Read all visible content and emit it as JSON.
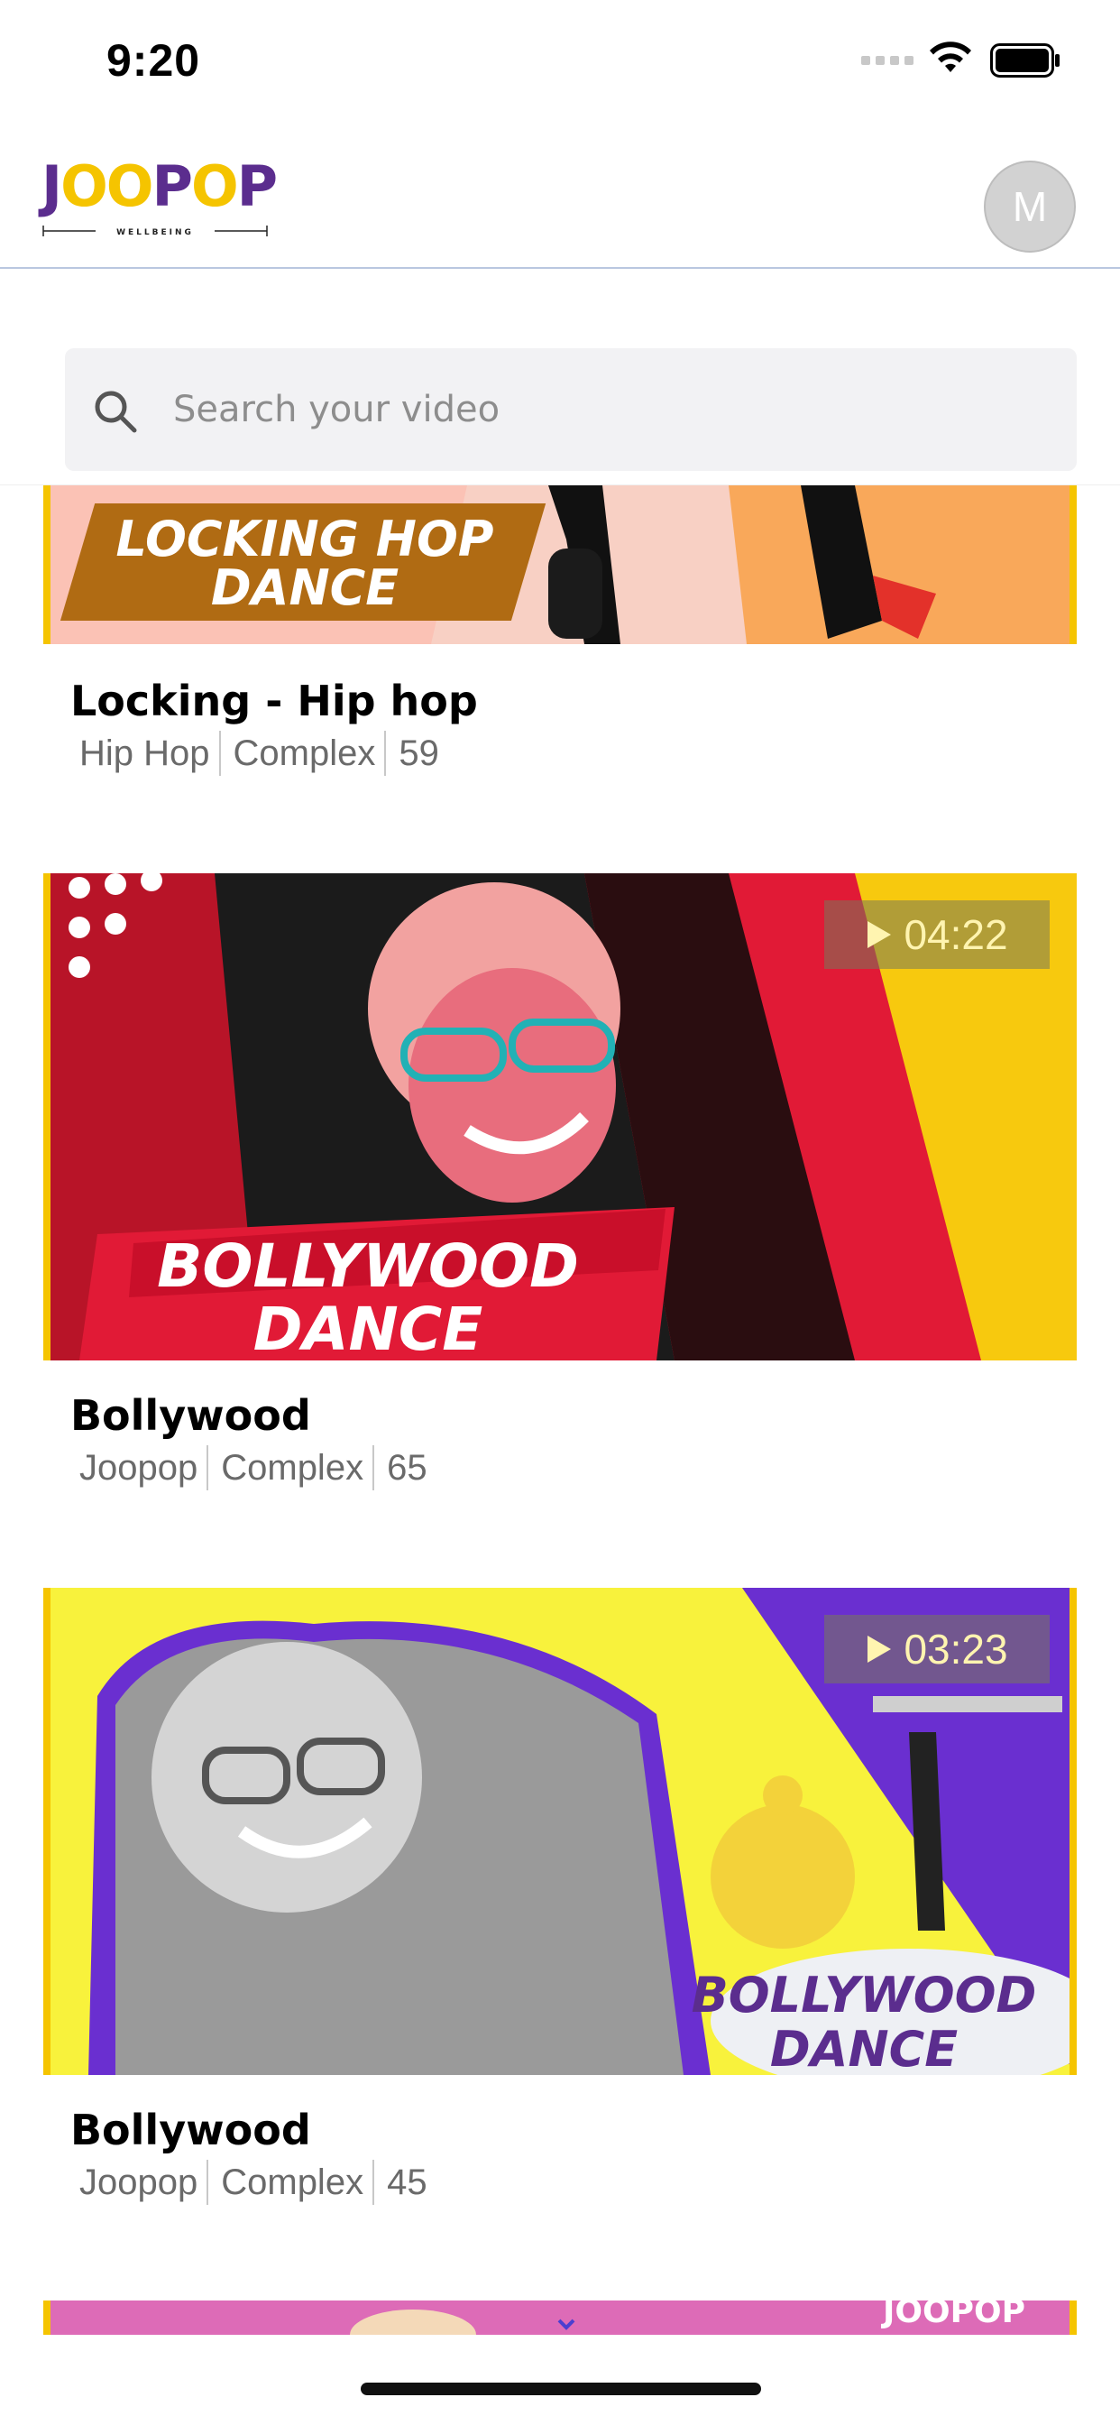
{
  "status_bar": {
    "time": "9:20"
  },
  "header": {
    "logo_text": "JOOPOP",
    "logo_subtitle": "WELLBEING",
    "avatar_initial": "M"
  },
  "search": {
    "placeholder": "Search your video",
    "value": ""
  },
  "videos": [
    {
      "title": "Locking - Hip hop",
      "teacher": "Hip Hop",
      "level": "Complex",
      "count": "59",
      "thumbnail_text_line1": "LOCKING HOP",
      "thumbnail_text_line2": "DANCE"
    },
    {
      "title": "Bollywood",
      "teacher": "Joopop",
      "level": "Complex",
      "count": "65",
      "duration": "04:22",
      "thumbnail_text_line1": "BOLLYWOOD",
      "thumbnail_text_line2": "DANCE"
    },
    {
      "title": "Bollywood",
      "teacher": "Joopop",
      "level": "Complex",
      "count": "45",
      "duration": "03:23",
      "thumbnail_text_line1": "BOLLYWOOD",
      "thumbnail_text_line2": "DANCE"
    },
    {
      "title": "",
      "thumbnail_brand": "JOOPOP"
    }
  ],
  "colors": {
    "brand_purple": "#5b2d8e",
    "brand_yellow": "#f5c400",
    "accent_red": "#e11a36",
    "bg_pink": "#fbc2b5"
  }
}
